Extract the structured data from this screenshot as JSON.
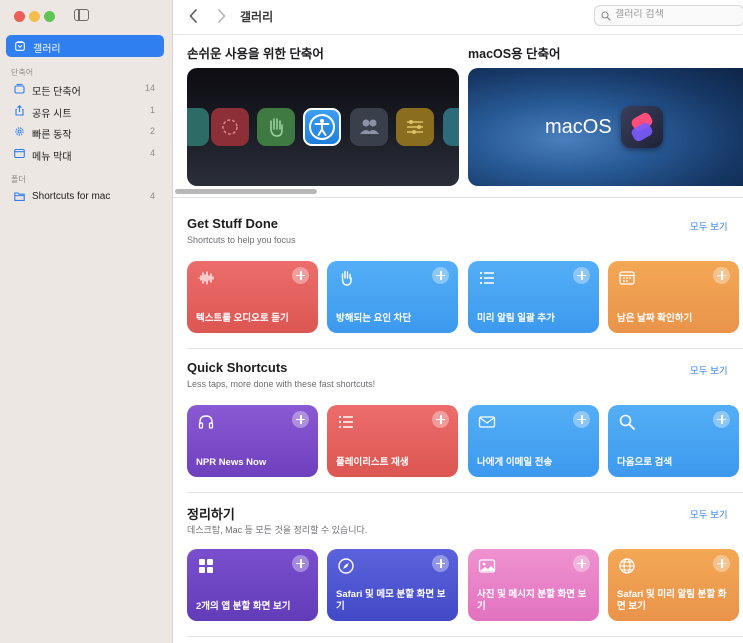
{
  "sidebar": {
    "gallery_label": "갤러리",
    "section_shortcuts": "단축어",
    "items": [
      {
        "label": "모든 단축어",
        "count": "14",
        "icon": "stack-icon"
      },
      {
        "label": "공유 시트",
        "count": "1",
        "icon": "share-icon"
      },
      {
        "label": "빠른 동작",
        "count": "2",
        "icon": "gear-icon"
      },
      {
        "label": "메뉴 막대",
        "count": "4",
        "icon": "menubar-icon"
      }
    ],
    "section_folders": "폴더",
    "folders": [
      {
        "label": "Shortcuts for mac",
        "count": "4",
        "icon": "folder-icon"
      }
    ]
  },
  "toolbar": {
    "title": "갤러리",
    "search_placeholder": "갤러리 검색"
  },
  "featured": {
    "left_title": "손쉬운 사용을 위한 단축어",
    "right_title": "macOS용 단축어",
    "right_banner_text": "macOS"
  },
  "sections": [
    {
      "title": "Get Stuff Done",
      "subtitle": "Shortcuts to help you focus",
      "see_all": "모두 보기",
      "tiles": [
        {
          "label": "텍스트를 오디오로 듣기",
          "color": "red",
          "icon": "waveform-icon"
        },
        {
          "label": "방해되는 요인 차단",
          "color": "blue",
          "icon": "hand-icon"
        },
        {
          "label": "미리 알림 일괄 추가",
          "color": "blue",
          "icon": "list-icon"
        },
        {
          "label": "남은 날짜 확인하기",
          "color": "orange",
          "icon": "calendar-icon"
        }
      ]
    },
    {
      "title": "Quick Shortcuts",
      "subtitle": "Less taps, more done with these fast shortcuts!",
      "see_all": "모두 보기",
      "tiles": [
        {
          "label": "NPR News Now",
          "color": "purple",
          "icon": "headphones-icon"
        },
        {
          "label": "플레이리스트 재생",
          "color": "red",
          "icon": "list-icon"
        },
        {
          "label": "나에게 이메일 전송",
          "color": "blue",
          "icon": "envelope-icon"
        },
        {
          "label": "다음으로 검색",
          "color": "blue",
          "icon": "search-icon"
        }
      ]
    },
    {
      "title": "정리하기",
      "subtitle": "데스크탑, Mac 등 모든 것을 정리할 수 있습니다.",
      "see_all": "모두 보기",
      "tiles": [
        {
          "label": "2개의 앱 분할 화면 보기",
          "color": "darkpurple",
          "icon": "grid-icon"
        },
        {
          "label": "Safari 및 메모 분할 화면 보기",
          "color": "indigo",
          "icon": "compass-icon"
        },
        {
          "label": "사진 및 메시지 분할 화면 보기",
          "color": "pink",
          "icon": "photo-icon"
        },
        {
          "label": "Safari 및 미리 알림 분할 화면 보기",
          "color": "orange",
          "icon": "globe-icon"
        }
      ]
    }
  ]
}
